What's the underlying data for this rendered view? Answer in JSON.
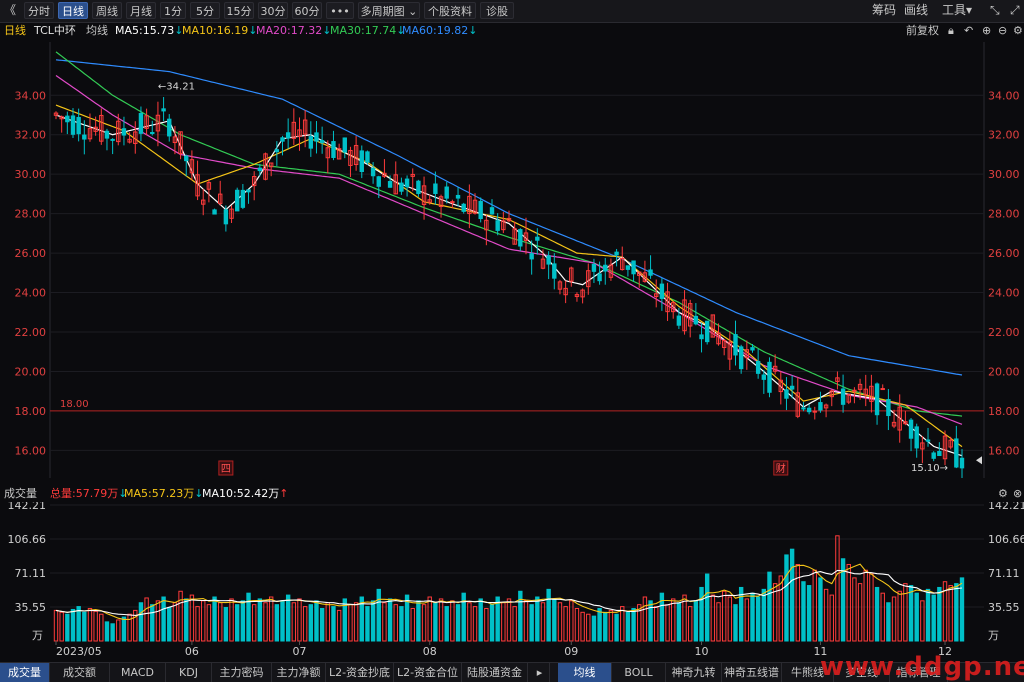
{
  "toolbar": {
    "back_glyph": "《",
    "periods": [
      "分时",
      "日线",
      "周线",
      "月线",
      "1分",
      "5分",
      "15分",
      "30分",
      "60分",
      "•••",
      "多周期图 ⌄",
      "个股资料",
      "诊股"
    ],
    "active_period": "日线",
    "right": [
      "筹码",
      "画线",
      "工具▾"
    ]
  },
  "info": {
    "period": "日线",
    "name": "TCL中环",
    "ma_label": "均线",
    "ma5": "MA5:15.73",
    "ma10": "MA10:16.19",
    "ma20": "MA20:17.32",
    "ma30": "MA30:17.74",
    "ma60": "MA60:19.82",
    "adjust": "前复权"
  },
  "colors": {
    "up": "#ff3b3b",
    "down": "#00c0c8",
    "ma5": "#ffffff",
    "ma10": "#f5c518",
    "ma20": "#e24bc9",
    "ma30": "#33cc55",
    "ma60": "#2f8cff",
    "axis_text": "#e04040"
  },
  "chart_data": [
    {
      "type": "candlestick",
      "yticks": [
        "34.00",
        "32.00",
        "30.00",
        "28.00",
        "26.00",
        "24.00",
        "22.00",
        "20.00",
        "18.00",
        "16.00"
      ],
      "ylim": [
        14.6,
        36.7
      ],
      "xlim": [
        0,
        160
      ],
      "dates": [
        "2023/05",
        "06",
        "07",
        "08",
        "09",
        "10",
        "11",
        "12"
      ],
      "date_index": [
        0,
        24,
        43,
        66,
        91,
        114,
        135,
        157
      ],
      "reference_line": 18.0,
      "reference_label": "18.00",
      "high_label": "←34.21",
      "low_label": "15.10→",
      "markers": [
        "四",
        "财"
      ],
      "marker_index": [
        30,
        128
      ],
      "ma60_anchors": [
        [
          0,
          35.8
        ],
        [
          20,
          35.2
        ],
        [
          40,
          33.8
        ],
        [
          60,
          31.0
        ],
        [
          80,
          28.0
        ],
        [
          100,
          25.7
        ],
        [
          120,
          23.0
        ],
        [
          140,
          20.8
        ],
        [
          160,
          19.82
        ]
      ],
      "ma30_anchors": [
        [
          0,
          36.2
        ],
        [
          10,
          34.0
        ],
        [
          22,
          32.0
        ],
        [
          35,
          30.5
        ],
        [
          50,
          30.0
        ],
        [
          65,
          28.3
        ],
        [
          80,
          26.8
        ],
        [
          95,
          25.5
        ],
        [
          110,
          23.5
        ],
        [
          125,
          21.0
        ],
        [
          140,
          19.1
        ],
        [
          152,
          18.0
        ],
        [
          160,
          17.74
        ]
      ],
      "ma20_anchors": [
        [
          0,
          35.0
        ],
        [
          10,
          33.0
        ],
        [
          22,
          31.0
        ],
        [
          35,
          30.3
        ],
        [
          50,
          29.8
        ],
        [
          65,
          28.0
        ],
        [
          80,
          26.2
        ],
        [
          95,
          25.5
        ],
        [
          110,
          23.0
        ],
        [
          125,
          20.3
        ],
        [
          140,
          18.8
        ],
        [
          152,
          18.2
        ],
        [
          160,
          17.32
        ]
      ],
      "ma10_anchors": [
        [
          0,
          33.5
        ],
        [
          12,
          32.2
        ],
        [
          25,
          29.5
        ],
        [
          35,
          30.5
        ],
        [
          45,
          31.8
        ],
        [
          55,
          30.6
        ],
        [
          65,
          28.6
        ],
        [
          80,
          27.7
        ],
        [
          92,
          26.0
        ],
        [
          100,
          25.8
        ],
        [
          110,
          23.3
        ],
        [
          122,
          21.0
        ],
        [
          132,
          18.5
        ],
        [
          140,
          19.0
        ],
        [
          150,
          18.3
        ],
        [
          160,
          16.19
        ]
      ],
      "ma5_anchors": [
        [
          0,
          33.0
        ],
        [
          10,
          32.0
        ],
        [
          20,
          32.7
        ],
        [
          25,
          29.5
        ],
        [
          30,
          28.2
        ],
        [
          35,
          29.5
        ],
        [
          40,
          31.8
        ],
        [
          45,
          32.0
        ],
        [
          55,
          30.5
        ],
        [
          60,
          29.6
        ],
        [
          70,
          28.5
        ],
        [
          80,
          27.5
        ],
        [
          86,
          26.0
        ],
        [
          90,
          24.6
        ],
        [
          93,
          24.4
        ],
        [
          100,
          25.8
        ],
        [
          110,
          23.0
        ],
        [
          115,
          22.3
        ],
        [
          125,
          20.0
        ],
        [
          132,
          18.2
        ],
        [
          137,
          19.0
        ],
        [
          145,
          18.6
        ],
        [
          150,
          17.4
        ],
        [
          155,
          16.2
        ],
        [
          160,
          15.73
        ]
      ]
    },
    {
      "type": "bar",
      "title": "成交量",
      "total": "总量:57.79万",
      "ma5": "MA5:57.23万",
      "ma10": "MA10:52.42万",
      "yticks": [
        "142.21",
        "106.66",
        "71.11",
        "35.55"
      ],
      "unit": "万",
      "ylim": [
        0,
        142.21
      ],
      "volumes": [
        32,
        30,
        28,
        33,
        36,
        30,
        34,
        31,
        28,
        20,
        18,
        22,
        25,
        28,
        32,
        40,
        45,
        38,
        42,
        46,
        35,
        40,
        52,
        44,
        48,
        36,
        42,
        38,
        46,
        40,
        35,
        44,
        38,
        42,
        50,
        38,
        44,
        40,
        46,
        38,
        42,
        48,
        40,
        44,
        36,
        38,
        42,
        34,
        40,
        36,
        32,
        44,
        38,
        40,
        46,
        36,
        42,
        54,
        40,
        44,
        38,
        36,
        48,
        34,
        42,
        38,
        46,
        40,
        44,
        36,
        42,
        38,
        50,
        40,
        36,
        44,
        34,
        38,
        46,
        40,
        44,
        36,
        52,
        42,
        38,
        46,
        40,
        54,
        44,
        40,
        36,
        42,
        34,
        30,
        28,
        26,
        34,
        30,
        32,
        28,
        36,
        30,
        34,
        38,
        46,
        42,
        36,
        50,
        38,
        44,
        40,
        48,
        36,
        42,
        56,
        70,
        48,
        40,
        52,
        46,
        38,
        56,
        44,
        50,
        46,
        54,
        72,
        60,
        68,
        90,
        96,
        80,
        62,
        58,
        74,
        66,
        54,
        48,
        110,
        86,
        80,
        66,
        60,
        74,
        70,
        56,
        50,
        40,
        46,
        52,
        60,
        58,
        50,
        42,
        54,
        48,
        56,
        62,
        58,
        60,
        66
      ]
    }
  ],
  "volume_info": {
    "title": "成交量",
    "total": "总量:57.79万",
    "ma5": "MA5:57.23万",
    "ma10": "MA10:52.42万"
  },
  "bottom_tabs_left": [
    "成交量",
    "成交额",
    "MACD",
    "KDJ",
    "主力密码",
    "主力净额",
    "L2-资金抄底",
    "L2-资金合位",
    "陆股通资金"
  ],
  "bottom_tabs_right": [
    "均线",
    "BOLL",
    "神奇九转",
    "神奇五线谱",
    "牛熊线",
    "多空线",
    "指标管理"
  ],
  "watermark": "www.ddgp.net"
}
